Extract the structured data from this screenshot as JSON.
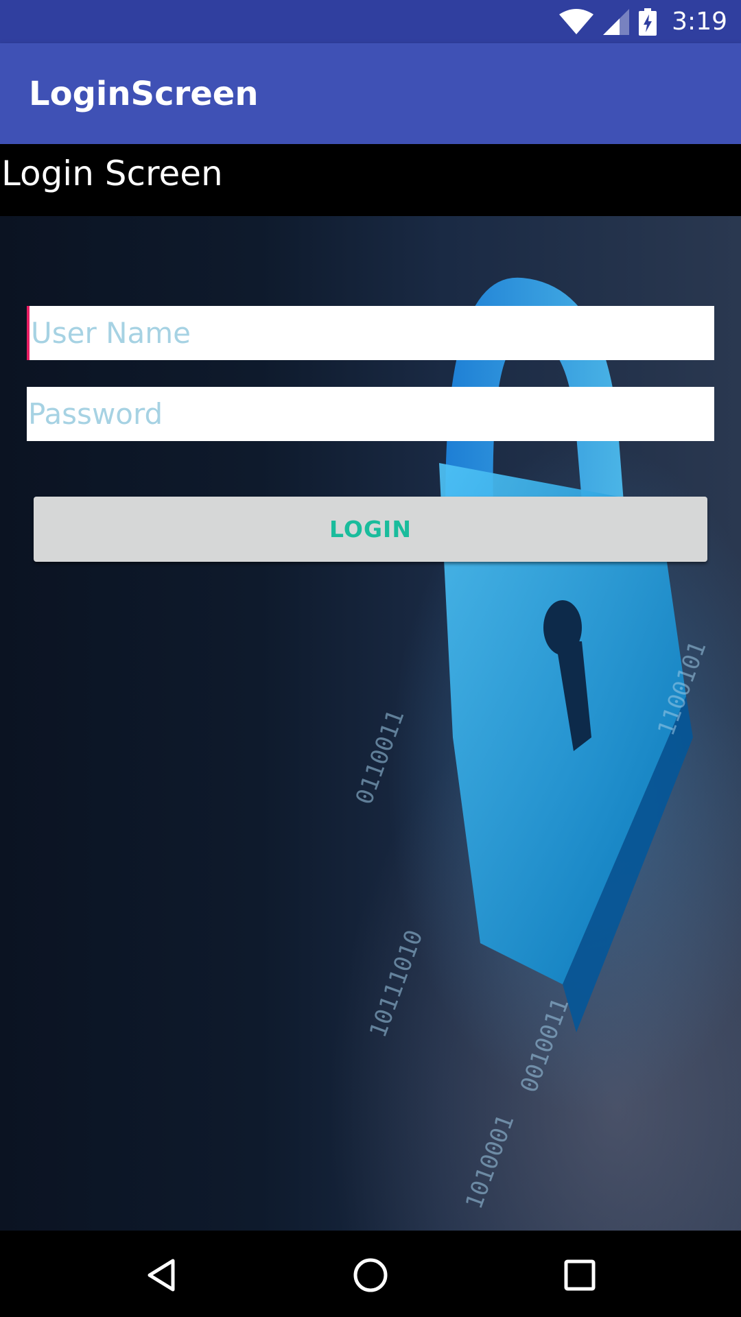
{
  "status_bar": {
    "time": "3:19",
    "icons": [
      "wifi-icon",
      "cell-signal-icon",
      "battery-charging-icon"
    ]
  },
  "app_bar": {
    "title": "LoginScreen"
  },
  "header": {
    "text": "Login Screen"
  },
  "form": {
    "username_placeholder": "User Name",
    "password_placeholder": "Password",
    "login_label": "LOGIN"
  },
  "nav_bar": {
    "icons": [
      "back-icon",
      "home-icon",
      "recents-icon"
    ]
  },
  "colors": {
    "status_bar": "#303f9f",
    "app_bar": "#3f51b5",
    "placeholder": "#a6d2e3",
    "login_text": "#1abc9c",
    "cursor": "#e91e63"
  }
}
